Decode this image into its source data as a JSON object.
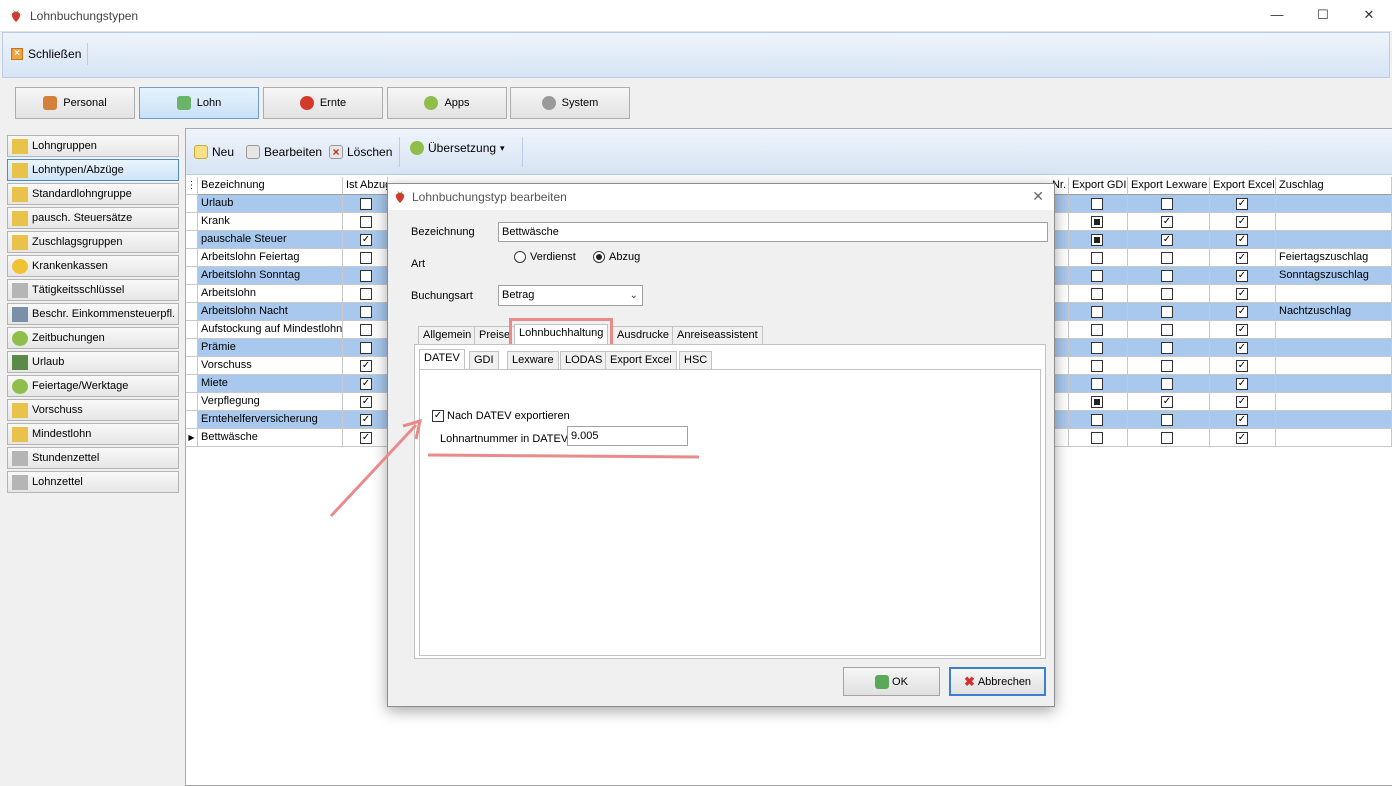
{
  "window": {
    "title": "Lohnbuchungstypen",
    "minimize": "—",
    "maximize": "☐",
    "close": "✕"
  },
  "toolbar": {
    "close_label": "Schließen"
  },
  "modules": [
    {
      "label": "Personal"
    },
    {
      "label": "Lohn"
    },
    {
      "label": "Ernte"
    },
    {
      "label": "Apps"
    },
    {
      "label": "System"
    }
  ],
  "nav": {
    "items": [
      {
        "label": "Lohngruppen"
      },
      {
        "label": "Lohntypen/Abzüge"
      },
      {
        "label": "Standardlohngruppe"
      },
      {
        "label": "pausch. Steuersätze"
      },
      {
        "label": "Zuschlagsgruppen"
      },
      {
        "label": "Krankenkassen"
      },
      {
        "label": "Tätigkeitsschlüssel"
      },
      {
        "label": "Beschr. Einkommensteuerpfl."
      },
      {
        "label": "Zeitbuchungen"
      },
      {
        "label": "Urlaub"
      },
      {
        "label": "Feiertage/Werktage"
      },
      {
        "label": "Vorschuss"
      },
      {
        "label": "Mindestlohn"
      },
      {
        "label": "Stundenzettel"
      },
      {
        "label": "Lohnzettel"
      }
    ]
  },
  "panel_toolbar": {
    "new": "Neu",
    "edit": "Bearbeiten",
    "delete": "Löschen",
    "translate": "Übersetzung",
    "dropdown_glyph": "▾"
  },
  "grid": {
    "headers": {
      "name": "Bezeichnung",
      "is_deduction": "Ist Abzug",
      "nr": "Nr.",
      "export_gdi": "Export GDI",
      "export_lexware": "Export Lexware",
      "export_excel": "Export Excel",
      "surcharge": "Zuschlag"
    },
    "current_row_marker": "▶",
    "rows": [
      {
        "name": "Urlaub",
        "abzug": false,
        "gdi": "empty",
        "lex": false,
        "excel": true,
        "zuschlag": "",
        "blue": true
      },
      {
        "name": "Krank",
        "abzug": false,
        "gdi": "filled",
        "lex": true,
        "excel": true,
        "zuschlag": "",
        "blue": false
      },
      {
        "name": "pauschale Steuer",
        "abzug": true,
        "gdi": "filled",
        "lex": true,
        "excel": true,
        "zuschlag": "",
        "blue": true
      },
      {
        "name": "Arbeitslohn Feiertag",
        "abzug": false,
        "gdi": "empty",
        "lex": false,
        "excel": true,
        "zuschlag": "Feiertagszuschlag",
        "blue": false
      },
      {
        "name": "Arbeitslohn Sonntag",
        "abzug": false,
        "gdi": "empty",
        "lex": false,
        "excel": true,
        "zuschlag": "Sonntagszuschlag",
        "blue": true
      },
      {
        "name": "Arbeitslohn",
        "abzug": false,
        "gdi": "empty",
        "lex": false,
        "excel": true,
        "zuschlag": "",
        "blue": false
      },
      {
        "name": "Arbeitslohn Nacht",
        "abzug": false,
        "gdi": "empty",
        "lex": false,
        "excel": true,
        "zuschlag": "Nachtzuschlag",
        "blue": true
      },
      {
        "name": "Aufstockung auf Mindestlohn",
        "abzug": false,
        "gdi": "empty",
        "lex": false,
        "excel": true,
        "zuschlag": "",
        "blue": false
      },
      {
        "name": "Prämie",
        "abzug": false,
        "gdi": "empty",
        "lex": false,
        "excel": true,
        "zuschlag": "",
        "blue": true
      },
      {
        "name": "Vorschuss",
        "abzug": true,
        "gdi": "empty",
        "lex": false,
        "excel": true,
        "zuschlag": "",
        "blue": false
      },
      {
        "name": "Miete",
        "abzug": true,
        "gdi": "empty",
        "lex": false,
        "excel": true,
        "zuschlag": "",
        "blue": true
      },
      {
        "name": "Verpflegung",
        "abzug": true,
        "gdi": "filled",
        "lex": true,
        "excel": true,
        "zuschlag": "",
        "blue": false
      },
      {
        "name": "Erntehelferversicherung",
        "abzug": true,
        "gdi": "empty",
        "lex": false,
        "excel": true,
        "zuschlag": "",
        "blue": true
      },
      {
        "name": "Bettwäsche",
        "abzug": true,
        "gdi": "empty",
        "lex": false,
        "excel": true,
        "zuschlag": "",
        "blue": false,
        "current": true
      }
    ]
  },
  "dialog": {
    "title": "Lohnbuchungstyp bearbeiten",
    "close": "✕",
    "name_label": "Bezeichnung",
    "name_value": "Bettwäsche",
    "art_label": "Art",
    "radio_earnings": "Verdienst",
    "radio_deduction": "Abzug",
    "booking_label": "Buchungsart",
    "booking_value": "Betrag",
    "combo_arrow": "⌄",
    "tabs": [
      "Allgemein",
      "Preise",
      "Lohnbuchhaltung",
      "Ausdrucke",
      "Anreiseassistent"
    ],
    "subtabs": [
      "DATEV",
      "GDI",
      "Lexware",
      "LODAS",
      "Export Excel",
      "HSC"
    ],
    "datev_checkbox": "Nach DATEV exportieren",
    "datev_checked": true,
    "datev_nr_label": "Lohnartnummer in DATEV",
    "datev_nr_value": "9.005",
    "ok": "OK",
    "cancel": "Abbrechen"
  },
  "colors": {
    "row_blue": "#a8c8ee",
    "annotation": "#e98b8b",
    "accent": "#3c7fd1"
  }
}
